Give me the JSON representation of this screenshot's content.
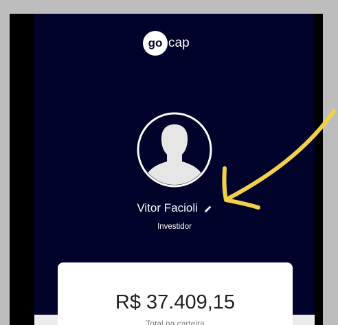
{
  "app": {
    "logo_bold": "go",
    "logo_rest": "cap"
  },
  "profile": {
    "name": "Vitor Facioli",
    "role": "Investidor",
    "avatar_icon": "user-silhouette-icon",
    "edit_icon": "pencil-icon"
  },
  "portfolio": {
    "amount": "R$ 37.409,15",
    "label": "Total na carteira"
  },
  "annotation": {
    "icon": "arrow-annotation-icon",
    "color": "#f2d14a"
  },
  "colors": {
    "background": "#02032a",
    "card": "#ffffff",
    "frame": "#bdbdbd"
  }
}
